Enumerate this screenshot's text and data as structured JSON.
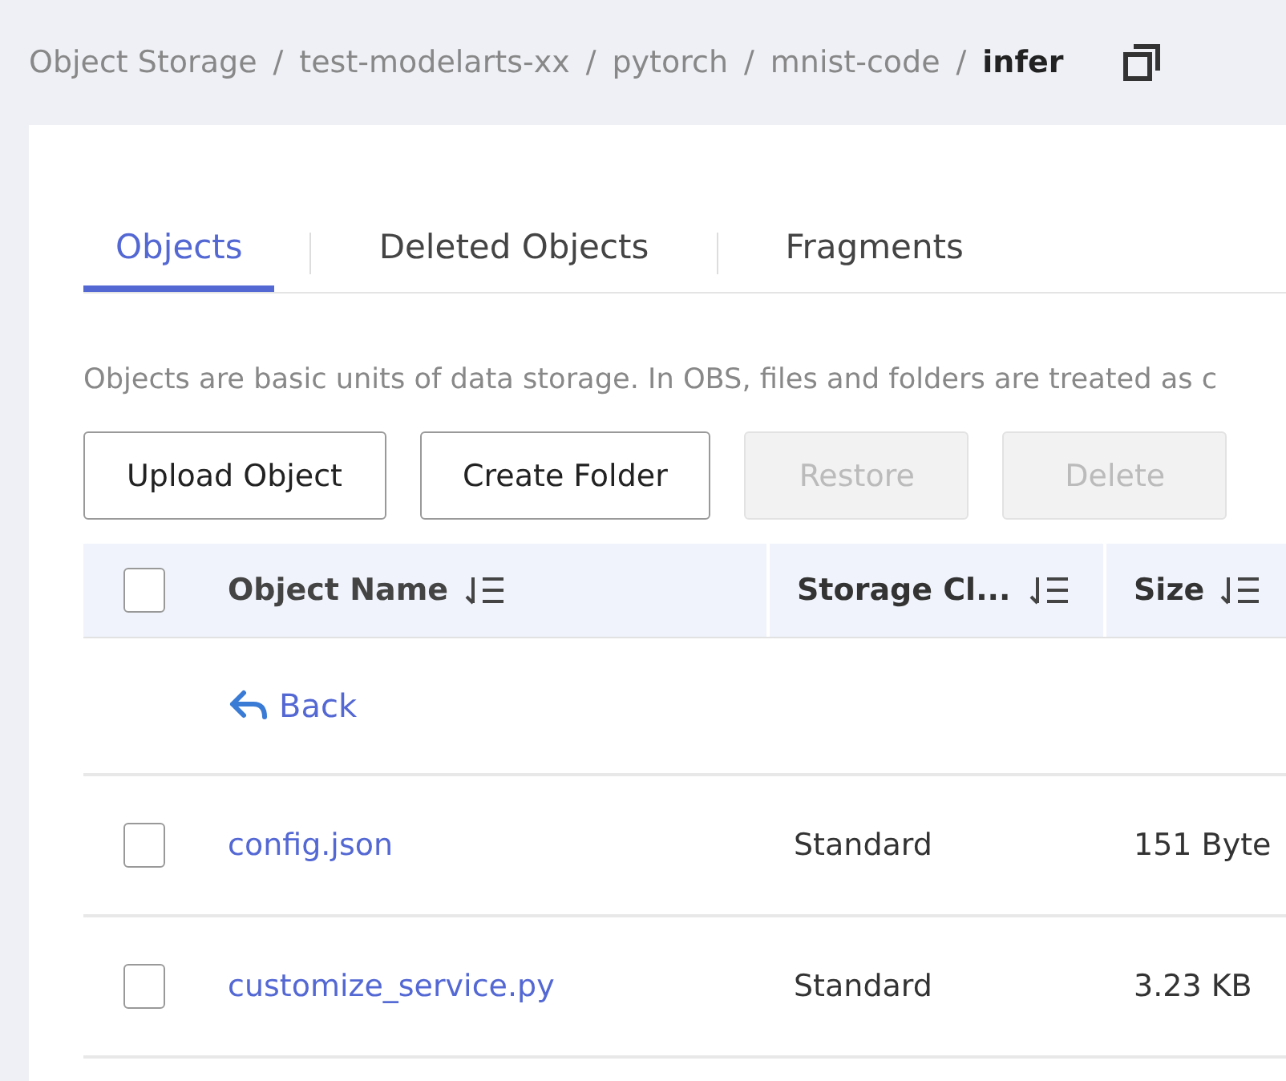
{
  "breadcrumb": {
    "items": [
      "Object Storage",
      "test-modelarts-xx",
      "pytorch",
      "mnist-code"
    ],
    "separator": "/",
    "current": "infer"
  },
  "tabs": [
    {
      "label": "Objects",
      "selected": true
    },
    {
      "label": "Deleted Objects",
      "selected": false
    },
    {
      "label": "Fragments",
      "selected": false
    }
  ],
  "description": "Objects are basic units of data storage. In OBS, files and folders are treated as c",
  "buttons": [
    {
      "label": "Upload Object",
      "disabled": false
    },
    {
      "label": "Create Folder",
      "disabled": false
    },
    {
      "label": "Restore",
      "disabled": true
    },
    {
      "label": "Delete",
      "disabled": true
    }
  ],
  "table": {
    "select_all": {
      "checked": false
    },
    "columns": [
      "Object Name",
      "Storage Cl...",
      "Size"
    ],
    "back": "Back",
    "rows": [
      {
        "checked": false,
        "name": "config.json",
        "storage_class": "Standard",
        "size": "151 Byte"
      },
      {
        "checked": false,
        "name": "customize_service.py",
        "storage_class": "Standard",
        "size": "3.23 KB"
      }
    ]
  }
}
